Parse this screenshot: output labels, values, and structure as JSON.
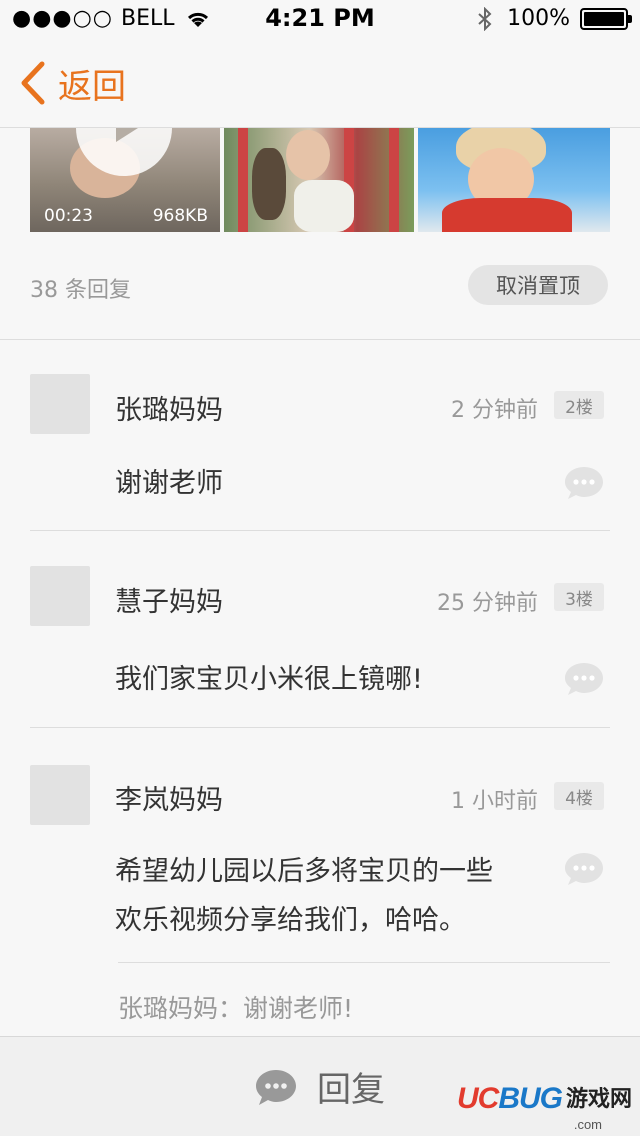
{
  "status_bar": {
    "signal": "●●●○○",
    "carrier": "BELL",
    "time": "4:21 PM",
    "battery": "100%"
  },
  "nav": {
    "back_label": "返回"
  },
  "media": {
    "video_duration": "00:23",
    "video_size": "968KB"
  },
  "thread": {
    "reply_count": "38 条回复",
    "unpin_label": "取消置顶"
  },
  "comments": [
    {
      "name": "张璐妈妈",
      "time": "2 分钟前",
      "floor": "2楼",
      "text": "谢谢老师"
    },
    {
      "name": "慧子妈妈",
      "time": "25 分钟前",
      "floor": "3楼",
      "text": "我们家宝贝小米很上镜哪!"
    },
    {
      "name": "李岚妈妈",
      "time": "1 小时前",
      "floor": "4楼",
      "text_line1": "希望幼儿园以后多将宝贝的一些",
      "text_line2": "欢乐视频分享给我们，哈哈。",
      "sub_reply": "张璐妈妈：谢谢老师!"
    }
  ],
  "bottom_bar": {
    "reply_label": "回复"
  },
  "watermark": {
    "logo_uc": "UC",
    "logo_bug": "BUG",
    "cn": "游戏网",
    "domain": ".com"
  },
  "colors": {
    "accent": "#e8731e",
    "background": "#f7f7f7",
    "divider": "#dddddd"
  }
}
